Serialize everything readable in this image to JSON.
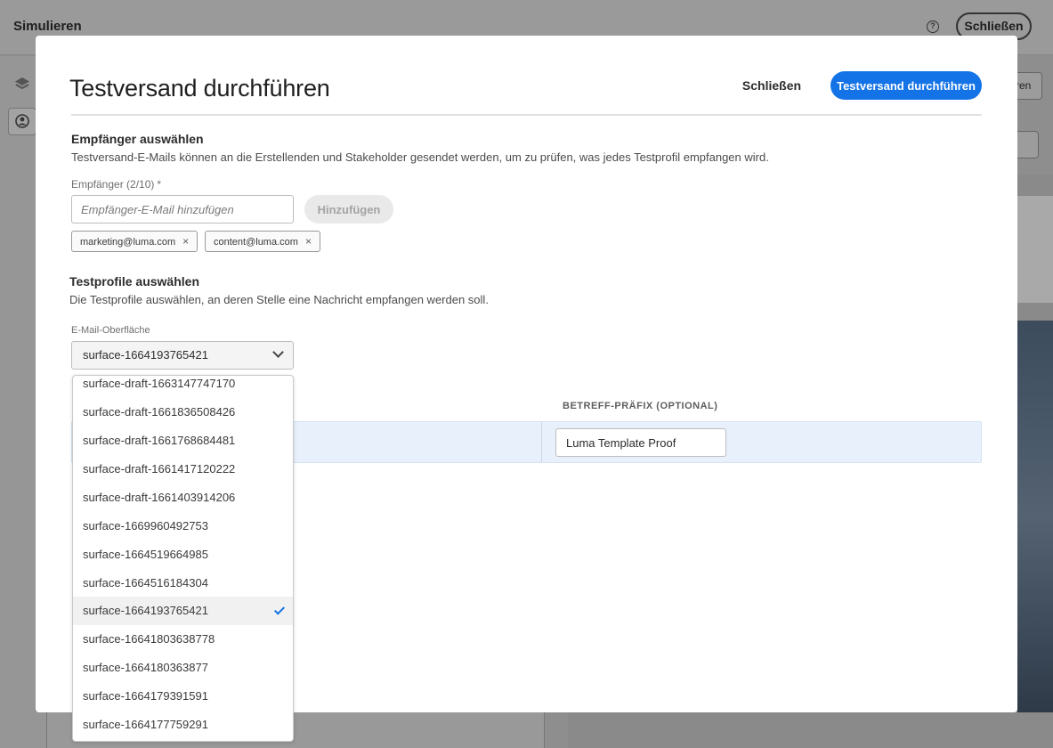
{
  "app": {
    "title": "Simulieren",
    "help_icon": "help-icon",
    "close_label": "Schließen",
    "partial_btn": "ren"
  },
  "modal": {
    "title": "Testversand durchführen",
    "close_label": "Schließen",
    "primary_label": "Testversand durchführen"
  },
  "recipients": {
    "title": "Empfänger auswählen",
    "description": "Testversand-E-Mails können an die Erstellenden und Stakeholder gesendet werden, um zu prüfen, was jedes Testprofil empfangen wird.",
    "field_label": "Empfänger (2/10)",
    "required_mark": "*",
    "input_placeholder": "Empfänger-E-Mail hinzufügen",
    "add_label": "Hinzufügen",
    "tags": [
      "marketing@luma.com",
      "content@luma.com"
    ],
    "tag_remove": "×"
  },
  "profiles": {
    "title": "Testprofile auswählen",
    "description": "Die Testprofile auswählen, an deren Stelle eine Nachricht empfangen werden soll.",
    "surface_label": "E-Mail-Oberfläche",
    "surface_selected": "surface-1664193765421",
    "col_subject_prefix": "BETREFF-PRÄFIX (OPTIONAL)",
    "subject_prefix_value": "Luma Template Proof"
  },
  "dropdown": {
    "items": [
      "surface-draft-1663147747170",
      "surface-draft-1661836508426",
      "surface-draft-1661768684481",
      "surface-draft-1661417120222",
      "surface-draft-1661403914206",
      "surface-1669960492753",
      "surface-1664519664985",
      "surface-1664516184304",
      "surface-1664193765421",
      "surface-16641803638778",
      "surface-1664180363877",
      "surface-1664179391591",
      "surface-1664177759291"
    ],
    "selected_index": 8
  }
}
